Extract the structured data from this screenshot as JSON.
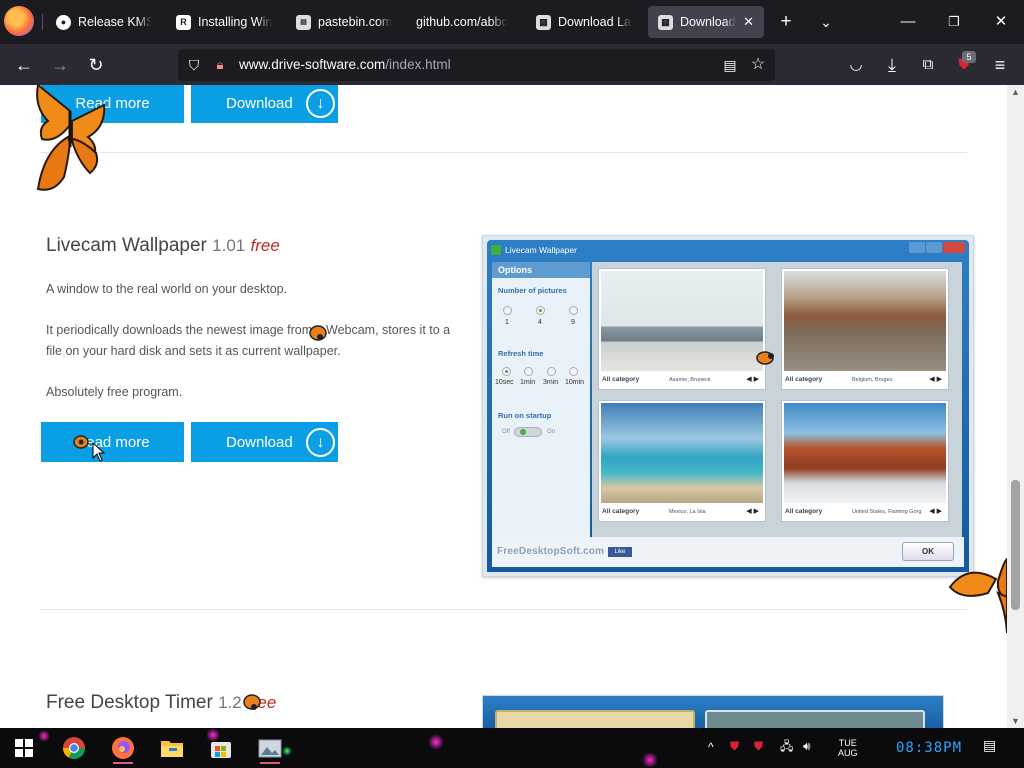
{
  "browser": {
    "tabs": [
      {
        "label": "Release KMSpi",
        "icon": "github-icon",
        "active": false
      },
      {
        "label": "Installing Wind",
        "icon": "r-site-icon",
        "active": false
      },
      {
        "label": "pastebin.com/",
        "icon": "pastebin-icon",
        "active": false
      },
      {
        "label": "github.com/abbo",
        "icon": "none",
        "active": false
      },
      {
        "label": "Download Lad",
        "icon": "page-icon",
        "active": false
      },
      {
        "label": "Download A",
        "icon": "page-icon",
        "active": true
      }
    ],
    "url_host": "www.drive-software.com",
    "url_path": "/index.html",
    "extension_badge": "5"
  },
  "page": {
    "top_buttons": {
      "read_more": "Read more",
      "download": "Download"
    },
    "products": [
      {
        "name": "Livecam Wallpaper",
        "version": "1.01",
        "price_tag": "free",
        "paragraphs": [
          "A window to the real world on your desktop.",
          "It periodically downloads the newest image from a Webcam, stores it to a file on your hard disk and sets it as current wallpaper.",
          "Absolutely free program."
        ],
        "read_more": "Read more",
        "download": "Download"
      },
      {
        "name": "Free Desktop Timer",
        "version": "1.2",
        "price_tag": "free"
      }
    ],
    "screenshot": {
      "window_title": "Livecam Wallpaper",
      "sidebar_header": "Options",
      "num_pictures_label": "Number of pictures",
      "num_pictures_options": [
        "1",
        "4",
        "9"
      ],
      "refresh_label": "Refresh time",
      "refresh_options": [
        "10sec",
        "1min",
        "3min",
        "10min"
      ],
      "startup_label": "Run on startup",
      "toggle_off": "Off",
      "toggle_on": "On",
      "pictures": [
        {
          "category": "All category",
          "location": "Asamie, Bruneck"
        },
        {
          "category": "All category",
          "location": "Belgium, Bruges"
        },
        {
          "category": "All category",
          "location": "Mexico, La Isla"
        },
        {
          "category": "All category",
          "location": "United States, Flaming Gorg"
        }
      ],
      "footer_brand": "FreeDesktopSoft.com",
      "like_label": "Like",
      "ok_label": "OK"
    }
  },
  "taskbar": {
    "day": "TUE",
    "month": "AUG",
    "time": "08:38PM"
  },
  "colors": {
    "accent_button": "#0a9fe4",
    "free_tag": "#c12727",
    "clock": "#2aa5ff"
  }
}
